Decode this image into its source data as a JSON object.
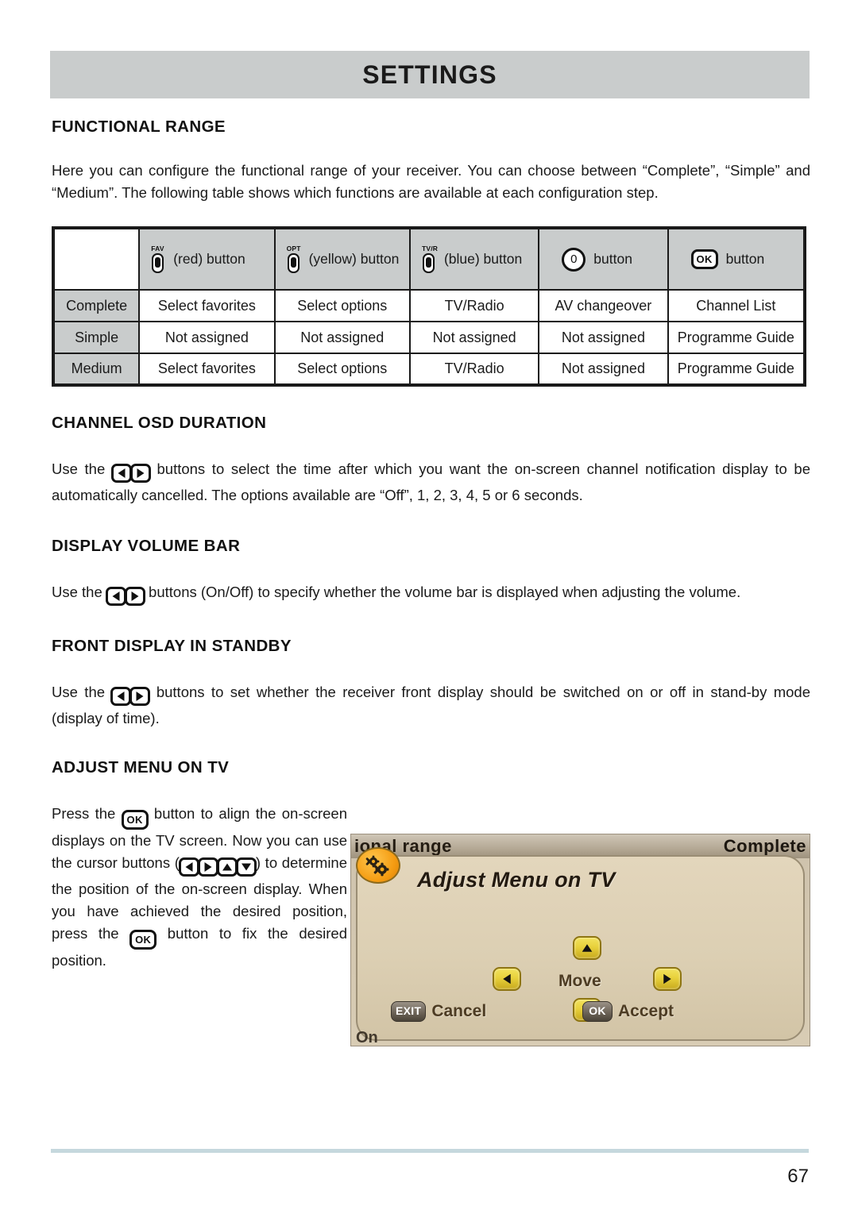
{
  "header": {
    "title": "SETTINGS"
  },
  "sections": {
    "functional_range": {
      "heading": "FUNCTIONAL RANGE",
      "paragraph": "Here you can configure the functional range of your receiver. You can choose between “Complete”, “Simple” and “Medium”. The following table shows which functions are available at each configuration step."
    },
    "channel_osd": {
      "heading": "CHANNEL OSD DURATION",
      "text_before": "Use the",
      "text_after": "buttons to select the time after which you want the on-screen channel notification display to be automatically cancelled. The options available are “Off”, 1, 2, 3, 4, 5 or 6 seconds."
    },
    "display_volume_bar": {
      "heading": "DISPLAY VOLUME BAR",
      "text_before": "Use the",
      "text_after": "buttons (On/Off) to specify whether the volume bar is displayed when adjusting the volume."
    },
    "front_display": {
      "heading": "FRONT DISPLAY IN STANDBY",
      "text_before": "Use the",
      "text_after": "buttons to set whether the receiver front display should be switched on or off in stand-by mode (display of time)."
    },
    "adjust_menu": {
      "heading": "ADJUST MENU ON TV",
      "text_1": "Press the",
      "text_2": "button to align the on-screen displays on the TV screen. Now you can use the cursor buttons",
      "text_3": ") to determine the position of the on-screen display. When you have achieved the desired position, press",
      "text_4": "the",
      "text_5": "button to fix the desired position.",
      "paren_open": "("
    }
  },
  "table": {
    "column_headers": [
      {
        "key_label": "FAV",
        "icon": "remote-key-icon",
        "text": "(red) button"
      },
      {
        "key_label": "OPT",
        "icon": "remote-key-icon",
        "text": "(yellow) button"
      },
      {
        "key_label": "TV/R",
        "icon": "remote-key-icon",
        "text": "(blue) button"
      },
      {
        "key_label": "",
        "icon": "zero-button-icon",
        "text": "button"
      },
      {
        "key_label": "",
        "icon": "ok-button-icon",
        "text": "button"
      }
    ],
    "rows": [
      {
        "mode": "Complete",
        "cells": [
          "Select favorites",
          "Select options",
          "TV/Radio",
          "AV changeover",
          "Channel List"
        ]
      },
      {
        "mode": "Simple",
        "cells": [
          "Not assigned",
          "Not assigned",
          "Not assigned",
          "Not assigned",
          "Programme Guide"
        ]
      },
      {
        "mode": "Medium",
        "cells": [
          "Select favorites",
          "Select options",
          "TV/Radio",
          "Not assigned",
          "Programme Guide"
        ]
      }
    ]
  },
  "tv_screenshot": {
    "topbar_left": "ional range",
    "topbar_right": "Complete",
    "dialog_title": "Adjust Menu on TV",
    "move_label": "Move",
    "cancel_key": "EXIT",
    "cancel_label": "Cancel",
    "accept_key": "OK",
    "accept_label": "Accept",
    "bottom_ghost": "On"
  },
  "footer": {
    "page_number": "67"
  },
  "colors": {
    "header_bar": "#c9cccc",
    "table_header_bg": "#c9cccc",
    "footer_rule": "#c5d8dd",
    "text": "#1a1a1a"
  }
}
